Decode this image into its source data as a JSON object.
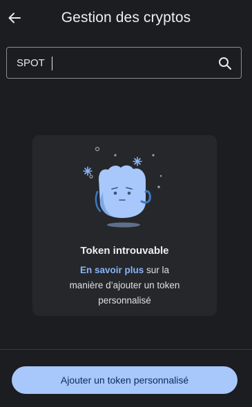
{
  "header": {
    "title": "Gestion des cryptos",
    "back_icon": "arrow-left-icon"
  },
  "search": {
    "value": "SPOT",
    "placeholder": "",
    "icon": "search-icon"
  },
  "empty_state": {
    "illustration": "confused-ghost-icon",
    "title": "Token introuvable",
    "link_text": "En savoir plus",
    "description_part1": " sur la",
    "description_part2": "manière d’ajouter un token",
    "description_part3": "personnalisé"
  },
  "footer": {
    "add_button_label": "Ajouter un token personnalisé"
  },
  "colors": {
    "background": "#1c1d20",
    "card": "#25272b",
    "accent": "#a8c7fa",
    "link": "#8ab4f8"
  }
}
